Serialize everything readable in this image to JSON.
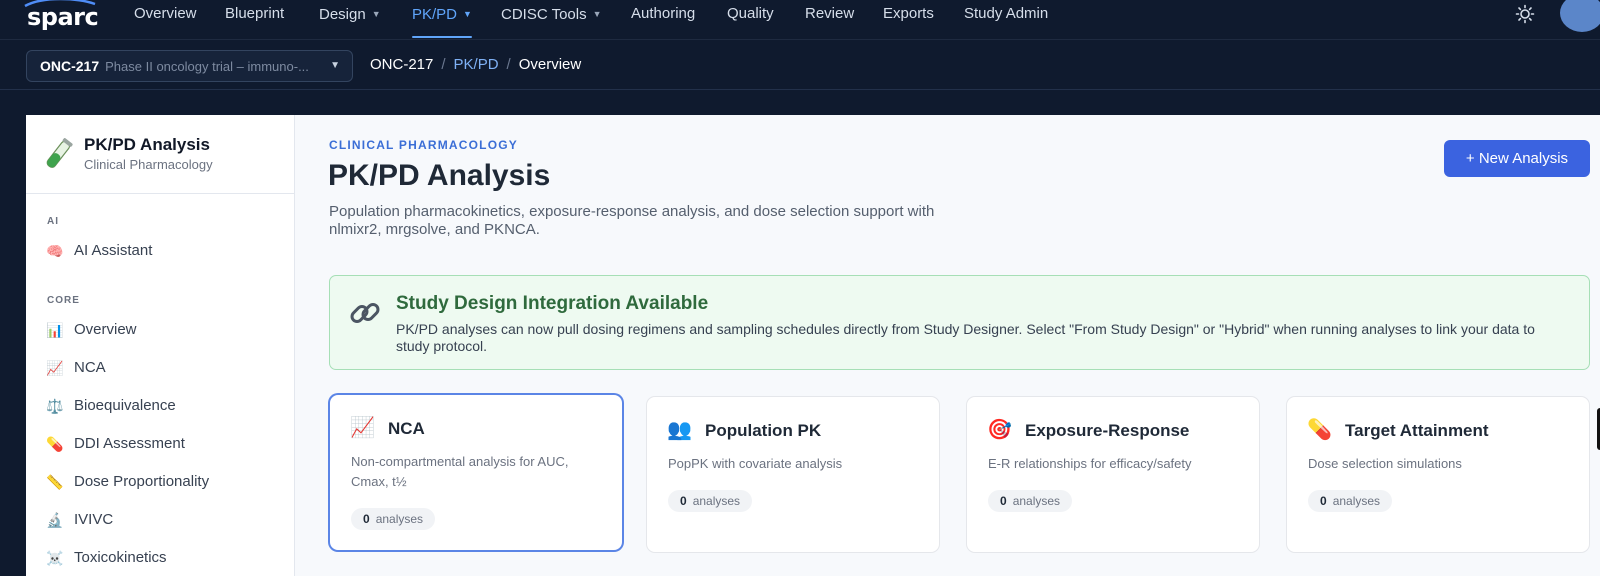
{
  "app": {
    "logo_text": "sparc"
  },
  "nav": {
    "items": [
      {
        "label": "Overview",
        "has_caret": false
      },
      {
        "label": "Blueprint",
        "has_caret": false
      },
      {
        "label": "Design",
        "has_caret": true
      },
      {
        "label": "PK/PD",
        "has_caret": true,
        "active": true
      },
      {
        "label": "CDISC Tools",
        "has_caret": true
      },
      {
        "label": "Authoring",
        "has_caret": false
      },
      {
        "label": "Quality",
        "has_caret": false
      },
      {
        "label": "Review",
        "has_caret": false
      },
      {
        "label": "Exports",
        "has_caret": false
      },
      {
        "label": "Study Admin",
        "has_caret": false
      }
    ],
    "theme_icon": "sun-icon"
  },
  "context": {
    "study_code": "ONC-217",
    "study_desc": "Phase II oncology trial – immuno-...",
    "breadcrumb": {
      "root": "ONC-217",
      "section": "PK/PD",
      "current": "Overview"
    }
  },
  "sidebar": {
    "title": "PK/PD Analysis",
    "subtitle": "Clinical Pharmacology",
    "sections": [
      {
        "heading": "AI",
        "items": [
          {
            "label": "AI Assistant",
            "icon": "brain-icon",
            "glyph": "🧠"
          }
        ]
      },
      {
        "heading": "CORE",
        "items": [
          {
            "label": "Overview",
            "icon": "bar-chart-icon",
            "glyph": "📊"
          },
          {
            "label": "NCA",
            "icon": "line-chart-icon",
            "glyph": "📈"
          },
          {
            "label": "Bioequivalence",
            "icon": "scales-icon",
            "glyph": "⚖️"
          },
          {
            "label": "DDI Assessment",
            "icon": "pill-icon",
            "glyph": "💊"
          },
          {
            "label": "Dose Proportionality",
            "icon": "ruler-icon",
            "glyph": "📏"
          },
          {
            "label": "IVIVC",
            "icon": "microscope-icon",
            "glyph": "🔬"
          },
          {
            "label": "Toxicokinetics",
            "icon": "skull-icon",
            "glyph": "☠️"
          }
        ]
      }
    ]
  },
  "main": {
    "eyebrow": "CLINICAL PHARMACOLOGY",
    "title": "PK/PD Analysis",
    "description": "Population pharmacokinetics, exposure-response analysis, and dose selection support with nlmixr2, mrgsolve, and PKNCA.",
    "new_button": "+ New Analysis",
    "banner": {
      "title": "Study Design Integration Available",
      "text": "PK/PD analyses can now pull dosing regimens and sampling schedules directly from Study Designer. Select \"From Study Design\" or \"Hybrid\" when running analyses to link your data to study protocol."
    },
    "cards": [
      {
        "title": "NCA",
        "icon": "line-chart-icon",
        "glyph": "📈",
        "desc": "Non-compartmental analysis for AUC, Cmax, t½",
        "count": "0",
        "count_label": "analyses",
        "selected": true
      },
      {
        "title": "Population PK",
        "icon": "people-icon",
        "glyph": "👥",
        "desc": "PopPK with covariate analysis",
        "count": "0",
        "count_label": "analyses"
      },
      {
        "title": "Exposure-Response",
        "icon": "target-icon",
        "glyph": "🎯",
        "desc": "E-R relationships for efficacy/safety",
        "count": "0",
        "count_label": "analyses"
      },
      {
        "title": "Target Attainment",
        "icon": "pill-icon",
        "glyph": "💊",
        "desc": "Dose selection simulations",
        "count": "0",
        "count_label": "analyses"
      }
    ]
  }
}
